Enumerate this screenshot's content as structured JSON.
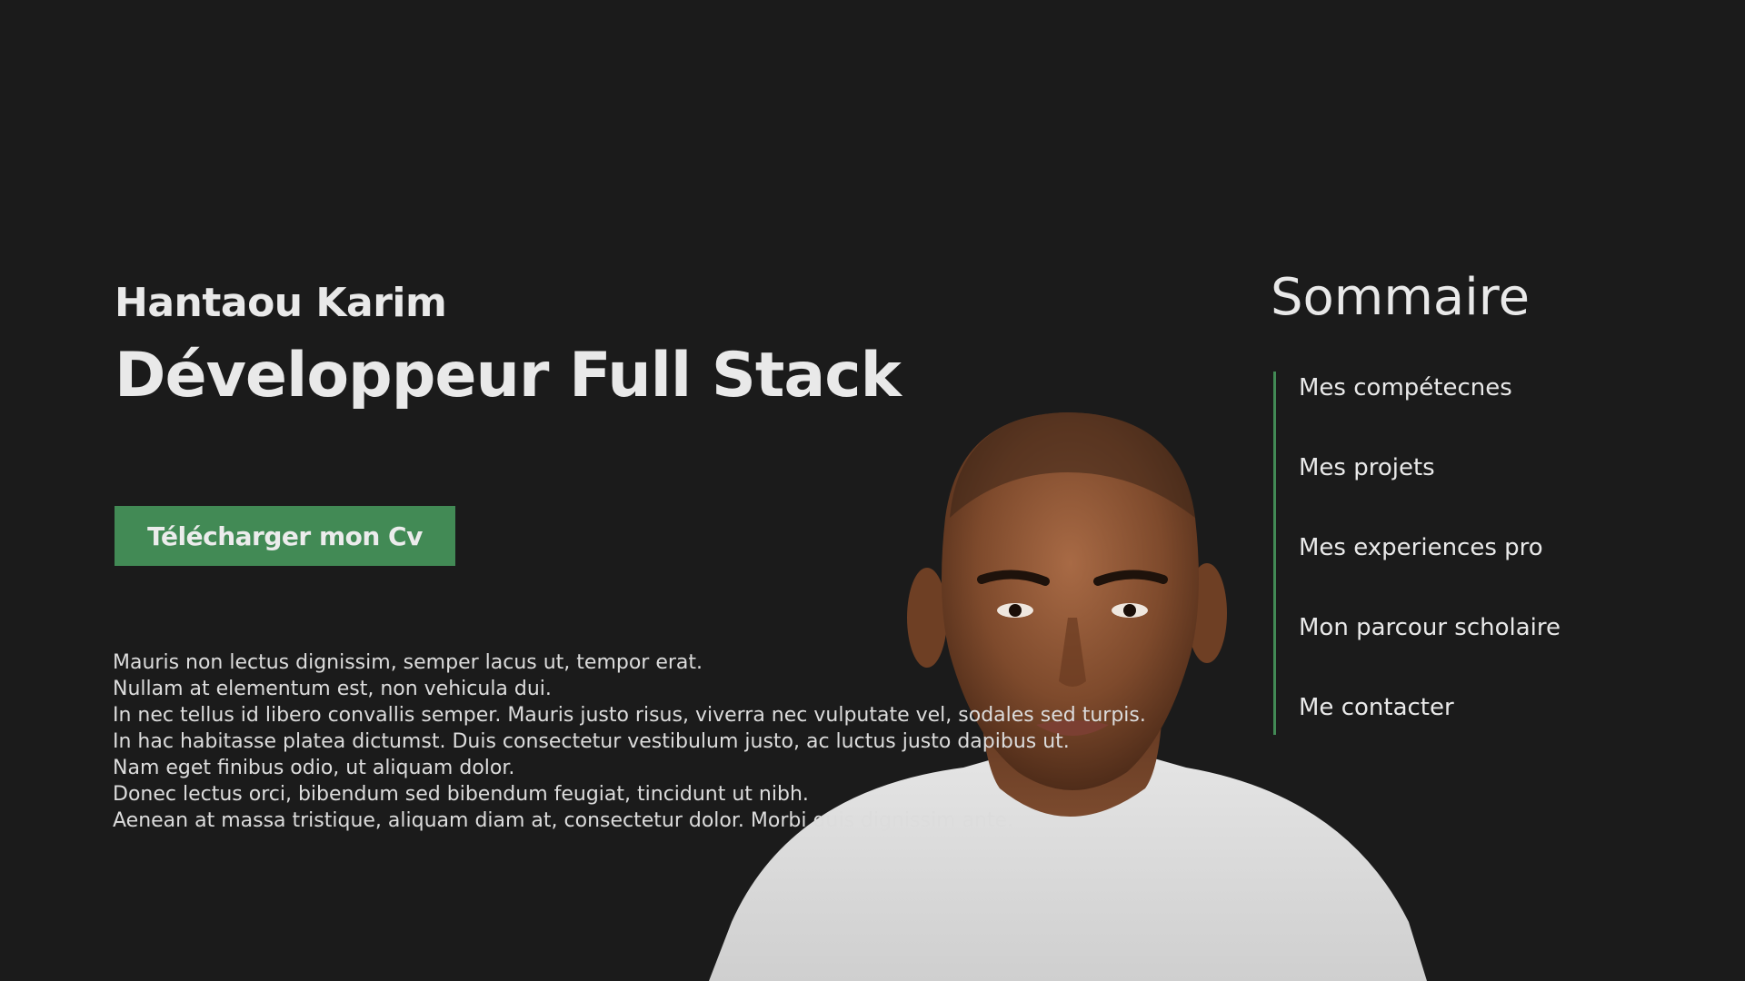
{
  "hero": {
    "name": "Hantaou Karim",
    "title": "Développeur Full Stack",
    "cv_button_label": "Télécharger mon Cv",
    "paragraph_lines": [
      "Mauris non lectus dignissim, semper lacus ut, tempor erat.",
      "Nullam at elementum est, non vehicula dui.",
      "In nec tellus id libero convallis semper. Mauris justo risus, viverra nec vulputate vel, sodales sed turpis.",
      "In hac habitasse platea dictumst. Duis consectetur vestibulum justo, ac luctus justo dapibus ut.",
      "Nam eget finibus odio, ut aliquam dolor.",
      "Donec lectus orci, bibendum sed bibendum feugiat, tincidunt ut nibh.",
      "Aenean at massa tristique, aliquam diam at, consectetur dolor. Morbi quis dignissim ante."
    ]
  },
  "toc": {
    "title": "Sommaire",
    "items": [
      "Mes compétecnes",
      "Mes projets",
      "Mes experiences pro",
      "Mon parcour scholaire",
      "Me contacter"
    ]
  },
  "colors": {
    "background": "#1b1b1b",
    "accent": "#428a55",
    "text": "#e9e9e9"
  }
}
